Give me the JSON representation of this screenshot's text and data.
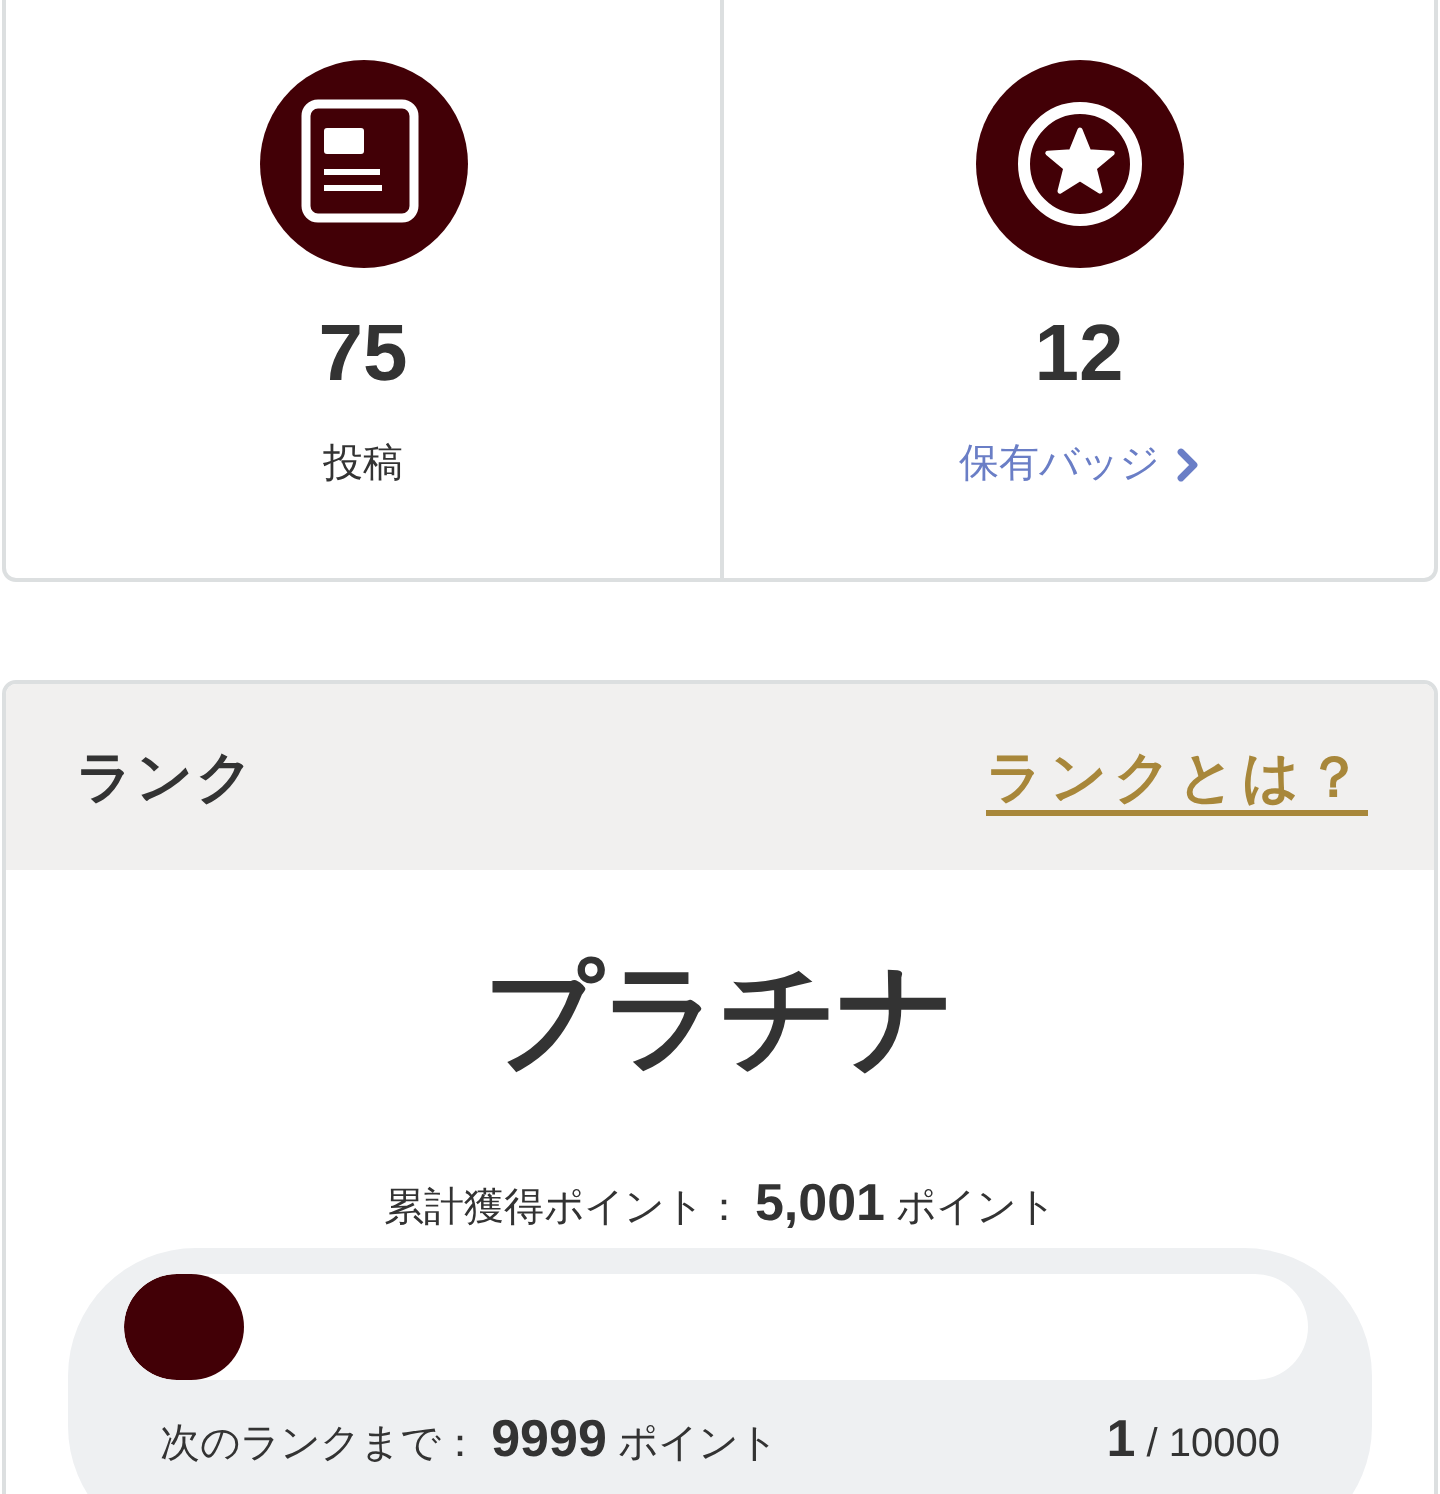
{
  "stats": [
    {
      "kind": "posts",
      "value": "75",
      "label": "投稿"
    },
    {
      "kind": "badges",
      "value": "12",
      "label": "保有バッジ"
    }
  ],
  "rank": {
    "title": "ランク",
    "help_link": "ランクとは？",
    "rank_name": "プラチナ",
    "total_text": "累計獲得ポイント： **5,001** ポイント",
    "progress": {
      "level": 0.0001,
      "next_text": "次のランクまで： **9999** ポイント",
      "count_text": "**1** / 10000"
    }
  }
}
